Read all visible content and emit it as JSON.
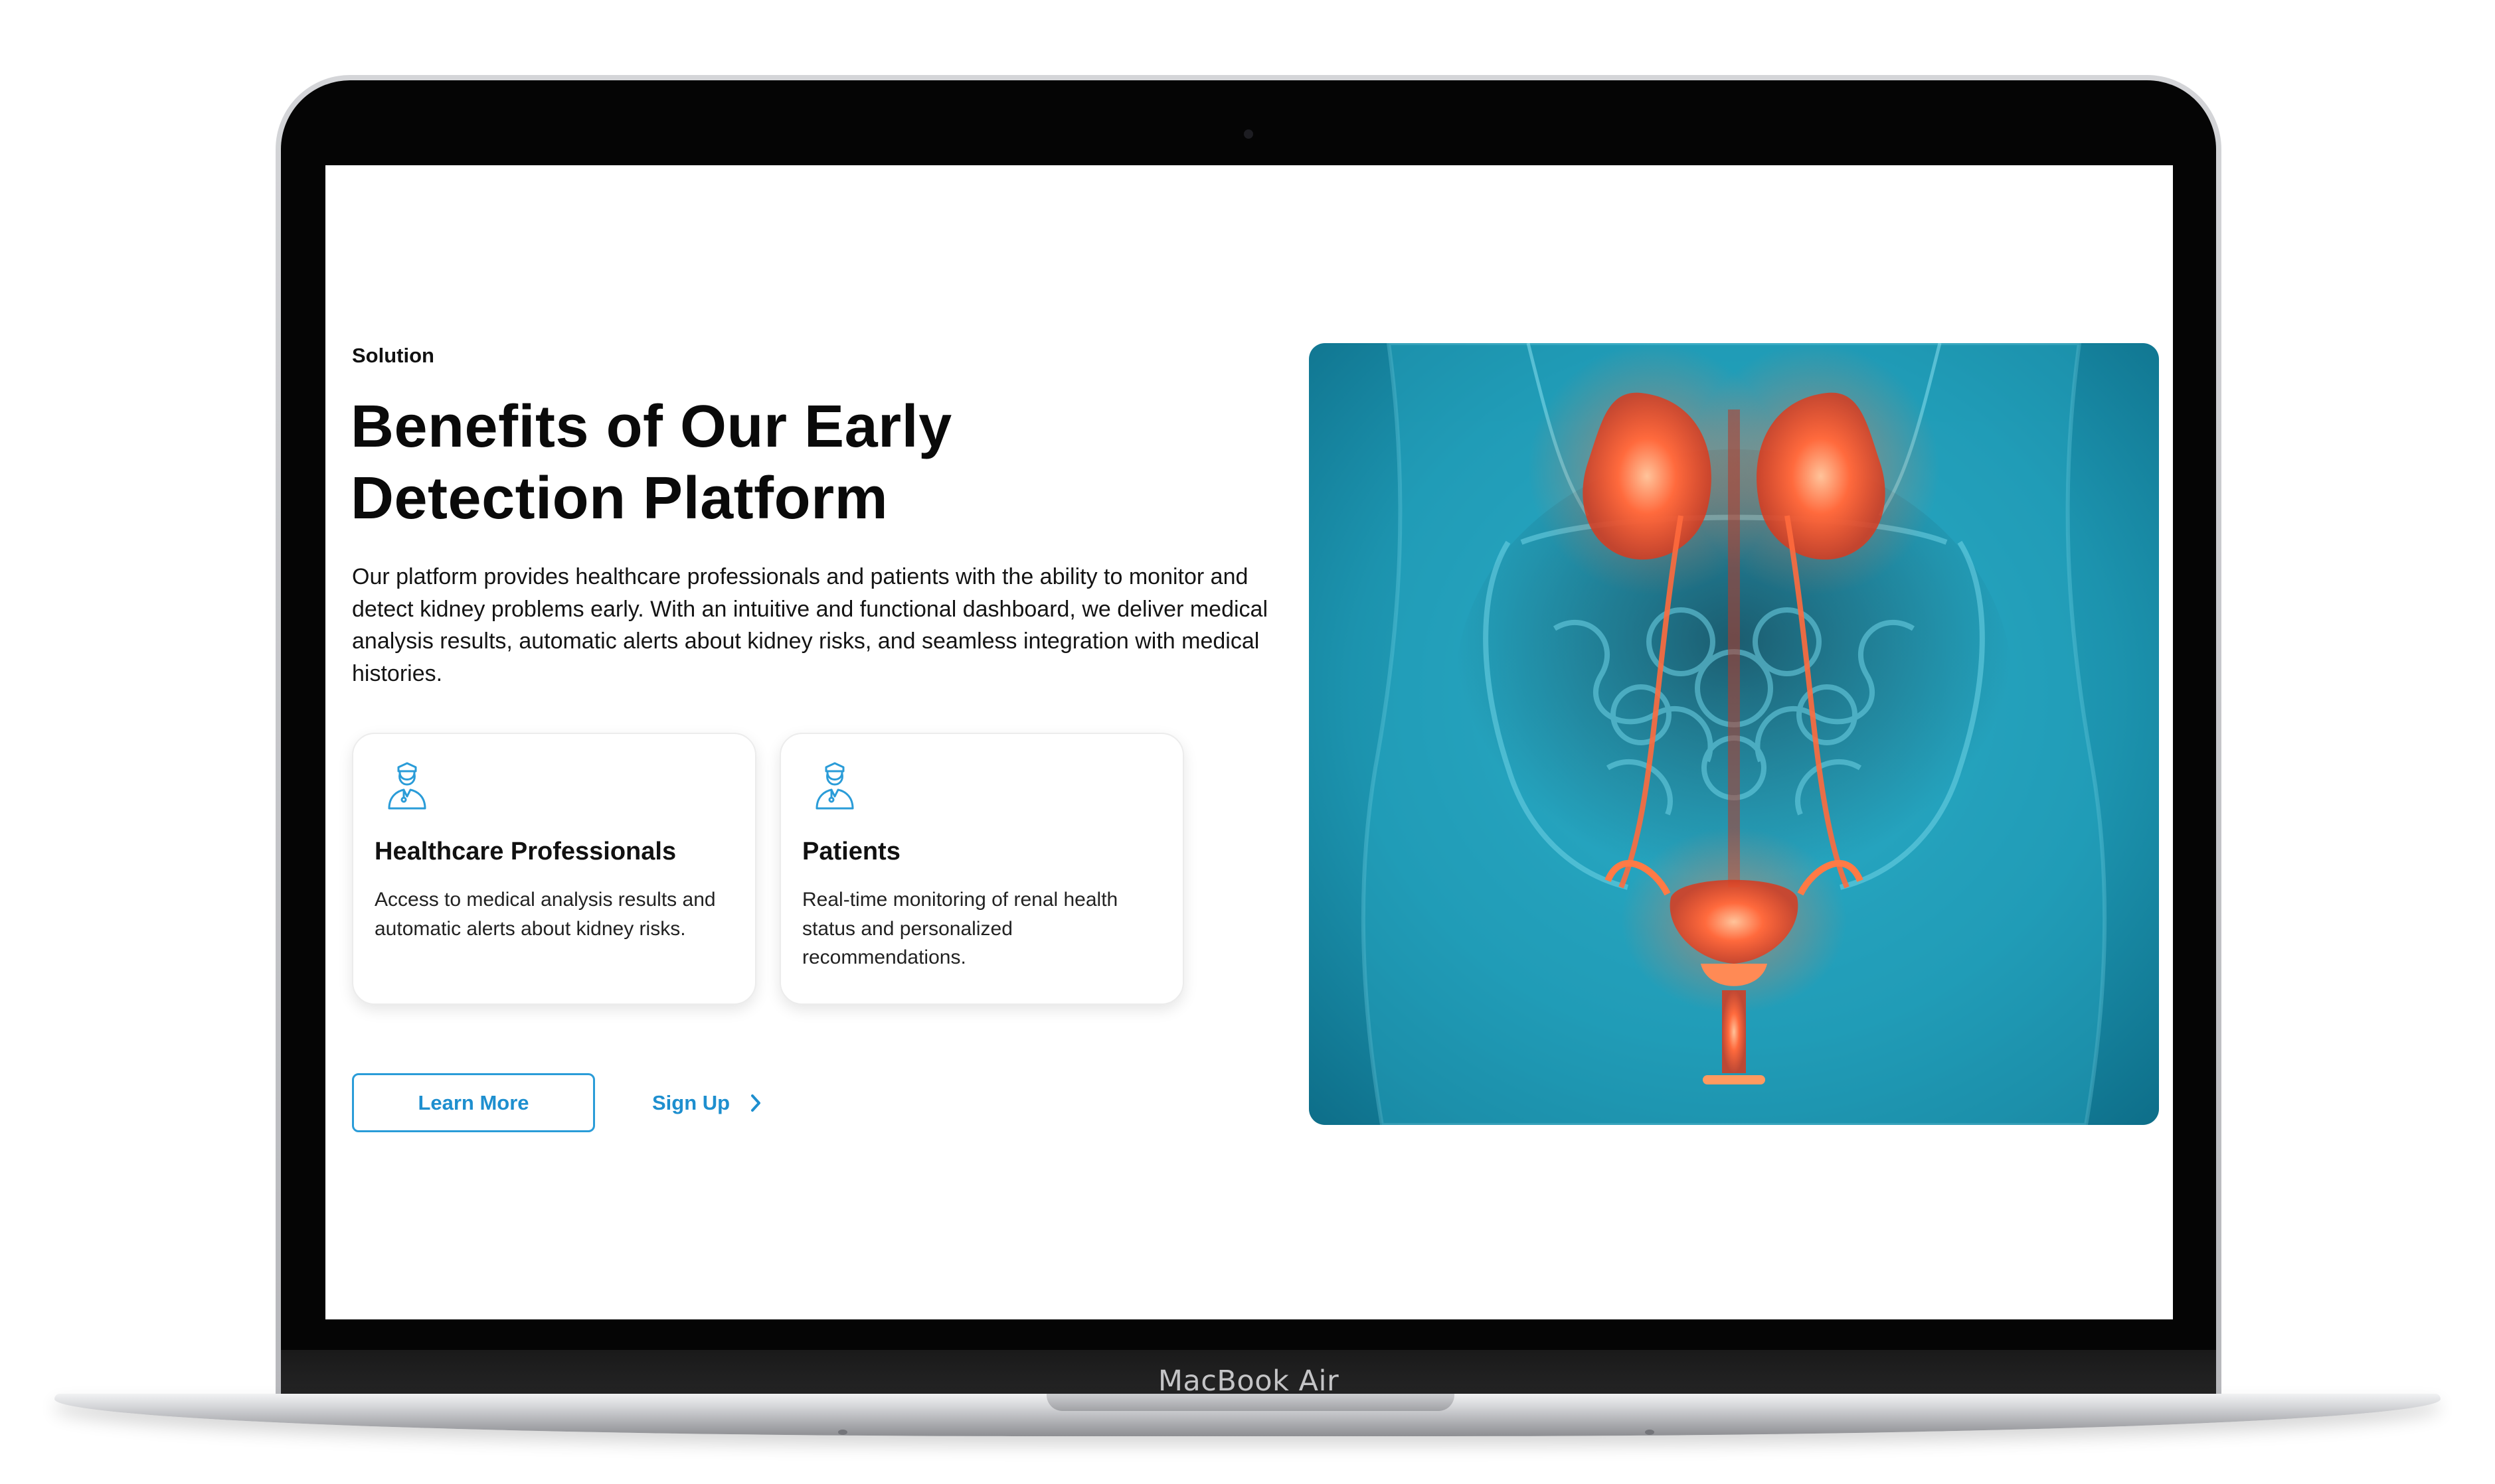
{
  "device": {
    "label": "MacBook Air"
  },
  "section": {
    "eyebrow": "Solution",
    "title_line1": "Benefits of Our Early",
    "title_line2": "Detection Platform",
    "description": "Our platform provides healthcare professionals and patients with the ability to monitor and detect kidney problems early. With an intuitive and functional dashboard, we deliver medical analysis results, automatic alerts about kidney risks, and seamless integration with medical histories."
  },
  "cards": [
    {
      "icon": "doctor-icon",
      "title": "Healthcare Professionals",
      "text": "Access to medical analysis results and automatic alerts about kidney risks."
    },
    {
      "icon": "doctor-icon",
      "title": "Patients",
      "text": "Real-time monitoring of renal health status and personalized recommendations."
    }
  ],
  "actions": {
    "learn_more": "Learn More",
    "sign_up": "Sign Up",
    "sign_up_icon": "chevron-right-icon"
  },
  "hero_image": {
    "subject": "kidney-anatomy-illustration"
  },
  "colors": {
    "accent": "#1e8fcf",
    "heading": "#0a0a0a",
    "hero_background": "#1b8fa8",
    "organ_glow": "#ff6a3d"
  }
}
